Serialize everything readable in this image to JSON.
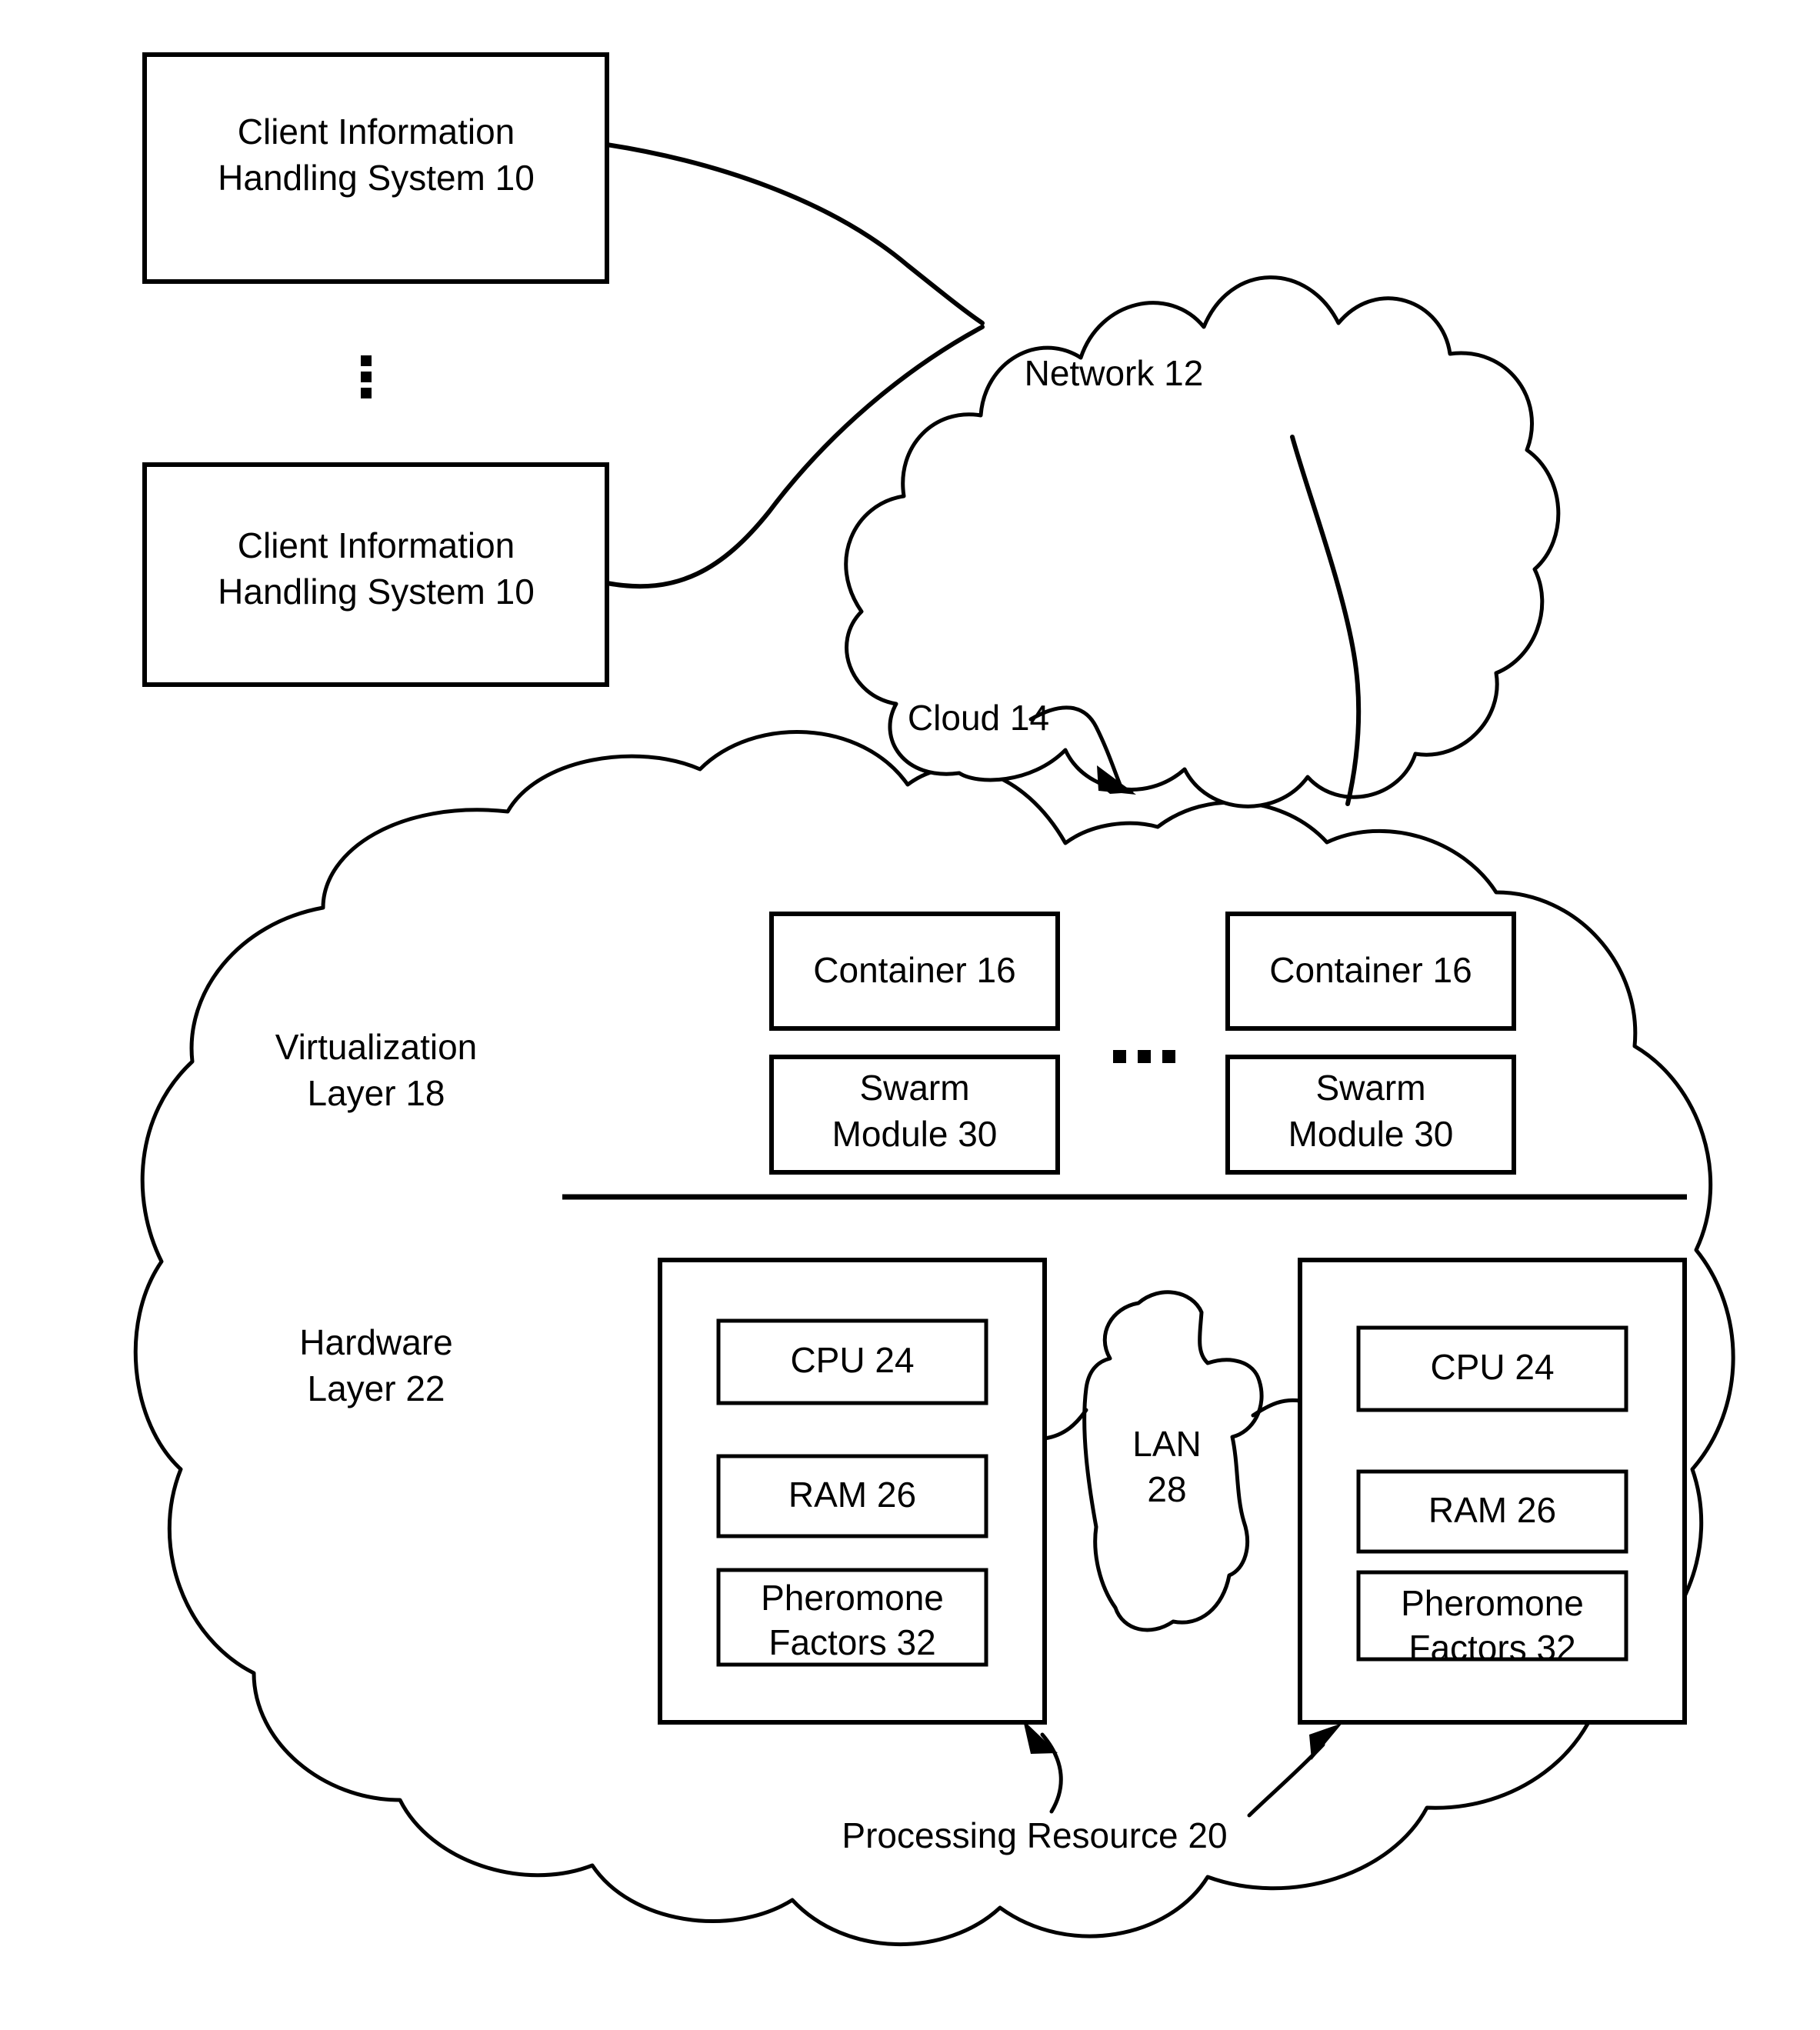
{
  "figure": {
    "type": "patent-system-diagram",
    "background_color": "#ffffff",
    "line_color": "#000000"
  },
  "clients": {
    "box_top_label_line1": "Client Information",
    "box_top_label_line2": "Handling System 10",
    "box_bottom_label_line1": "Client Information",
    "box_bottom_label_line2": "Handling System 10",
    "ellipsis_glyph": "vertical-ellipsis"
  },
  "network": {
    "label": "Network 12"
  },
  "cloud": {
    "label": "Cloud 14"
  },
  "layers": {
    "virtualization_line1": "Virtualization",
    "virtualization_line2": "Layer 18",
    "hardware_line1": "Hardware",
    "hardware_line2": "Layer 22"
  },
  "virtualization": {
    "containers": [
      {
        "container_label": "Container 16",
        "swarm_line1": "Swarm",
        "swarm_line2": "Module 30"
      },
      {
        "container_label": "Container 16",
        "swarm_line1": "Swarm",
        "swarm_line2": "Module 30"
      }
    ],
    "ellipsis_glyph": "horizontal-ellipsis"
  },
  "hardware": {
    "processing_resources": [
      {
        "cpu": "CPU 24",
        "ram": "RAM 26",
        "pheromone_line1": "Pheromone",
        "pheromone_line2": "Factors 32"
      },
      {
        "cpu": "CPU 24",
        "ram": "RAM 26",
        "pheromone_line1": "Pheromone",
        "pheromone_line2": "Factors 32"
      }
    ],
    "lan_line1": "LAN",
    "lan_line2": "28",
    "processing_resource_label": "Processing Resource 20"
  }
}
